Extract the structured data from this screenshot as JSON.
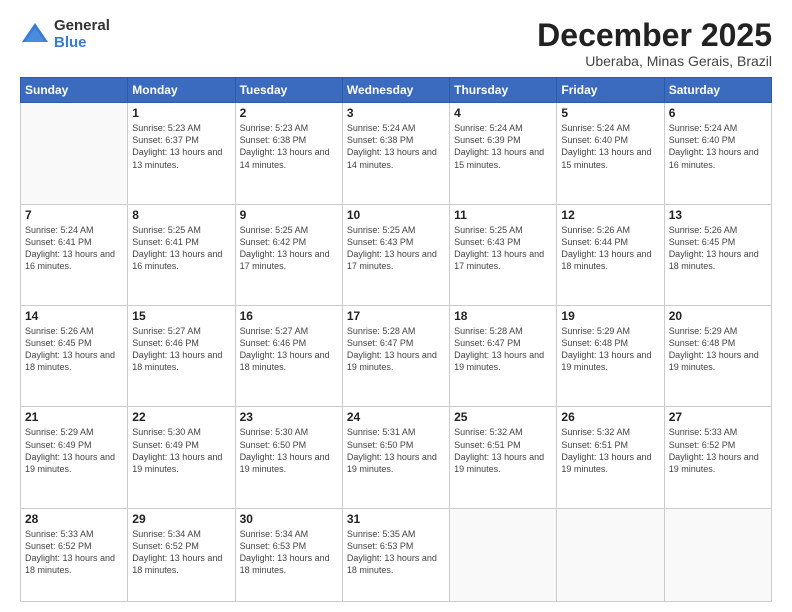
{
  "logo": {
    "general": "General",
    "blue": "Blue"
  },
  "header": {
    "month": "December 2025",
    "location": "Uberaba, Minas Gerais, Brazil"
  },
  "weekdays": [
    "Sunday",
    "Monday",
    "Tuesday",
    "Wednesday",
    "Thursday",
    "Friday",
    "Saturday"
  ],
  "weeks": [
    [
      {
        "day": "",
        "sunrise": "",
        "sunset": "",
        "daylight": ""
      },
      {
        "day": "1",
        "sunrise": "Sunrise: 5:23 AM",
        "sunset": "Sunset: 6:37 PM",
        "daylight": "Daylight: 13 hours and 13 minutes."
      },
      {
        "day": "2",
        "sunrise": "Sunrise: 5:23 AM",
        "sunset": "Sunset: 6:38 PM",
        "daylight": "Daylight: 13 hours and 14 minutes."
      },
      {
        "day": "3",
        "sunrise": "Sunrise: 5:24 AM",
        "sunset": "Sunset: 6:38 PM",
        "daylight": "Daylight: 13 hours and 14 minutes."
      },
      {
        "day": "4",
        "sunrise": "Sunrise: 5:24 AM",
        "sunset": "Sunset: 6:39 PM",
        "daylight": "Daylight: 13 hours and 15 minutes."
      },
      {
        "day": "5",
        "sunrise": "Sunrise: 5:24 AM",
        "sunset": "Sunset: 6:40 PM",
        "daylight": "Daylight: 13 hours and 15 minutes."
      },
      {
        "day": "6",
        "sunrise": "Sunrise: 5:24 AM",
        "sunset": "Sunset: 6:40 PM",
        "daylight": "Daylight: 13 hours and 16 minutes."
      }
    ],
    [
      {
        "day": "7",
        "sunrise": "Sunrise: 5:24 AM",
        "sunset": "Sunset: 6:41 PM",
        "daylight": "Daylight: 13 hours and 16 minutes."
      },
      {
        "day": "8",
        "sunrise": "Sunrise: 5:25 AM",
        "sunset": "Sunset: 6:41 PM",
        "daylight": "Daylight: 13 hours and 16 minutes."
      },
      {
        "day": "9",
        "sunrise": "Sunrise: 5:25 AM",
        "sunset": "Sunset: 6:42 PM",
        "daylight": "Daylight: 13 hours and 17 minutes."
      },
      {
        "day": "10",
        "sunrise": "Sunrise: 5:25 AM",
        "sunset": "Sunset: 6:43 PM",
        "daylight": "Daylight: 13 hours and 17 minutes."
      },
      {
        "day": "11",
        "sunrise": "Sunrise: 5:25 AM",
        "sunset": "Sunset: 6:43 PM",
        "daylight": "Daylight: 13 hours and 17 minutes."
      },
      {
        "day": "12",
        "sunrise": "Sunrise: 5:26 AM",
        "sunset": "Sunset: 6:44 PM",
        "daylight": "Daylight: 13 hours and 18 minutes."
      },
      {
        "day": "13",
        "sunrise": "Sunrise: 5:26 AM",
        "sunset": "Sunset: 6:45 PM",
        "daylight": "Daylight: 13 hours and 18 minutes."
      }
    ],
    [
      {
        "day": "14",
        "sunrise": "Sunrise: 5:26 AM",
        "sunset": "Sunset: 6:45 PM",
        "daylight": "Daylight: 13 hours and 18 minutes."
      },
      {
        "day": "15",
        "sunrise": "Sunrise: 5:27 AM",
        "sunset": "Sunset: 6:46 PM",
        "daylight": "Daylight: 13 hours and 18 minutes."
      },
      {
        "day": "16",
        "sunrise": "Sunrise: 5:27 AM",
        "sunset": "Sunset: 6:46 PM",
        "daylight": "Daylight: 13 hours and 18 minutes."
      },
      {
        "day": "17",
        "sunrise": "Sunrise: 5:28 AM",
        "sunset": "Sunset: 6:47 PM",
        "daylight": "Daylight: 13 hours and 19 minutes."
      },
      {
        "day": "18",
        "sunrise": "Sunrise: 5:28 AM",
        "sunset": "Sunset: 6:47 PM",
        "daylight": "Daylight: 13 hours and 19 minutes."
      },
      {
        "day": "19",
        "sunrise": "Sunrise: 5:29 AM",
        "sunset": "Sunset: 6:48 PM",
        "daylight": "Daylight: 13 hours and 19 minutes."
      },
      {
        "day": "20",
        "sunrise": "Sunrise: 5:29 AM",
        "sunset": "Sunset: 6:48 PM",
        "daylight": "Daylight: 13 hours and 19 minutes."
      }
    ],
    [
      {
        "day": "21",
        "sunrise": "Sunrise: 5:29 AM",
        "sunset": "Sunset: 6:49 PM",
        "daylight": "Daylight: 13 hours and 19 minutes."
      },
      {
        "day": "22",
        "sunrise": "Sunrise: 5:30 AM",
        "sunset": "Sunset: 6:49 PM",
        "daylight": "Daylight: 13 hours and 19 minutes."
      },
      {
        "day": "23",
        "sunrise": "Sunrise: 5:30 AM",
        "sunset": "Sunset: 6:50 PM",
        "daylight": "Daylight: 13 hours and 19 minutes."
      },
      {
        "day": "24",
        "sunrise": "Sunrise: 5:31 AM",
        "sunset": "Sunset: 6:50 PM",
        "daylight": "Daylight: 13 hours and 19 minutes."
      },
      {
        "day": "25",
        "sunrise": "Sunrise: 5:32 AM",
        "sunset": "Sunset: 6:51 PM",
        "daylight": "Daylight: 13 hours and 19 minutes."
      },
      {
        "day": "26",
        "sunrise": "Sunrise: 5:32 AM",
        "sunset": "Sunset: 6:51 PM",
        "daylight": "Daylight: 13 hours and 19 minutes."
      },
      {
        "day": "27",
        "sunrise": "Sunrise: 5:33 AM",
        "sunset": "Sunset: 6:52 PM",
        "daylight": "Daylight: 13 hours and 19 minutes."
      }
    ],
    [
      {
        "day": "28",
        "sunrise": "Sunrise: 5:33 AM",
        "sunset": "Sunset: 6:52 PM",
        "daylight": "Daylight: 13 hours and 18 minutes."
      },
      {
        "day": "29",
        "sunrise": "Sunrise: 5:34 AM",
        "sunset": "Sunset: 6:52 PM",
        "daylight": "Daylight: 13 hours and 18 minutes."
      },
      {
        "day": "30",
        "sunrise": "Sunrise: 5:34 AM",
        "sunset": "Sunset: 6:53 PM",
        "daylight": "Daylight: 13 hours and 18 minutes."
      },
      {
        "day": "31",
        "sunrise": "Sunrise: 5:35 AM",
        "sunset": "Sunset: 6:53 PM",
        "daylight": "Daylight: 13 hours and 18 minutes."
      },
      {
        "day": "",
        "sunrise": "",
        "sunset": "",
        "daylight": ""
      },
      {
        "day": "",
        "sunrise": "",
        "sunset": "",
        "daylight": ""
      },
      {
        "day": "",
        "sunrise": "",
        "sunset": "",
        "daylight": ""
      }
    ]
  ]
}
